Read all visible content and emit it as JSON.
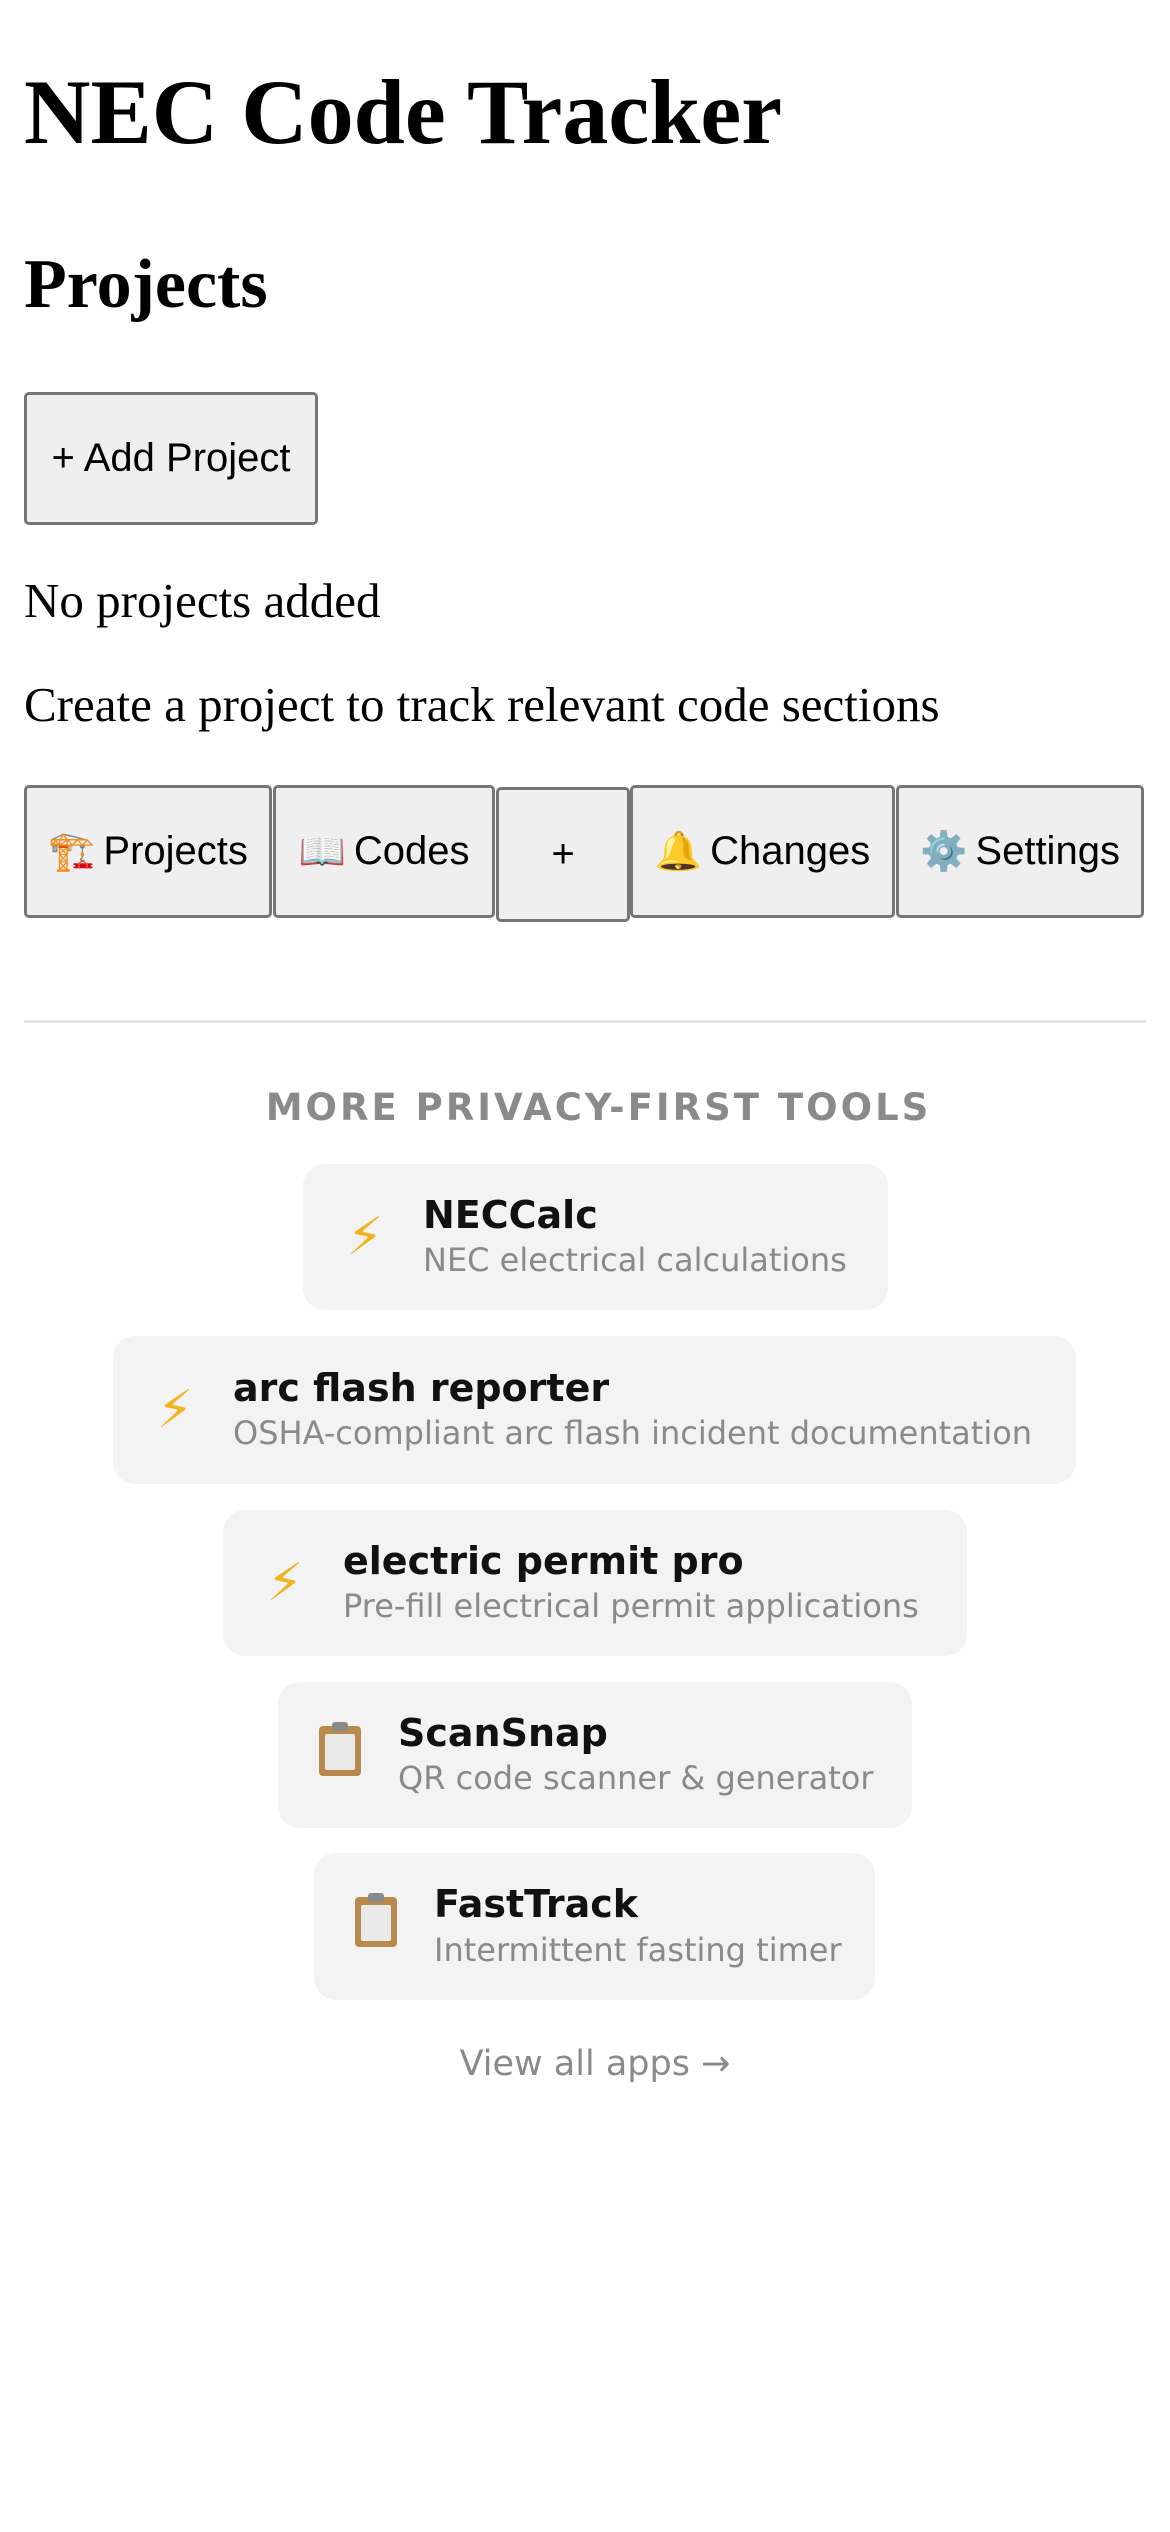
{
  "app": {
    "title": "NEC Code Tracker"
  },
  "projects": {
    "heading": "Projects",
    "add_button": "+ Add Project",
    "empty_title": "No projects added",
    "empty_subtitle": "Create a project to track relevant code sections"
  },
  "nav": {
    "projects": {
      "icon": "🏗️",
      "label": "Projects"
    },
    "codes": {
      "icon": "📖",
      "label": "Codes"
    },
    "add": {
      "label": "+"
    },
    "changes": {
      "icon": "🔔",
      "label": "Changes"
    },
    "settings": {
      "icon": "⚙️",
      "label": "Settings"
    }
  },
  "more_tools": {
    "heading": "MORE PRIVACY-FIRST TOOLS",
    "apps": [
      {
        "icon": "⚡",
        "name": "NECCalc",
        "description": "NEC electrical calculations"
      },
      {
        "icon": "⚡",
        "name": "arc flash reporter",
        "description": "OSHA-compliant arc flash incident documentation"
      },
      {
        "icon": "⚡",
        "name": "electric permit pro",
        "description": "Pre-fill electrical permit applications"
      },
      {
        "icon": "clipboard",
        "name": "ScanSnap",
        "description": "QR code scanner & generator"
      },
      {
        "icon": "clipboard",
        "name": "FastTrack",
        "description": "Intermittent fasting timer"
      }
    ],
    "view_all": "View all apps →"
  }
}
